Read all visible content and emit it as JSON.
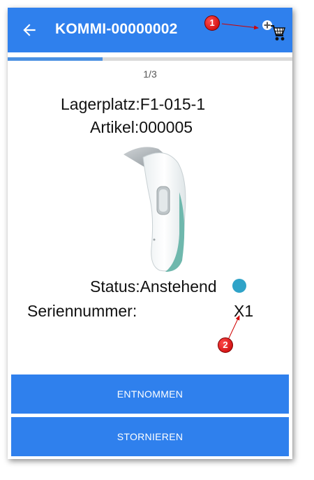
{
  "appbar": {
    "title": "KOMMI-00000002",
    "back_icon": "arrow-left-icon",
    "action_icon": "cart-add-icon",
    "color": "#2f80ed"
  },
  "progress": {
    "fraction": 0.333,
    "counter": "1/3"
  },
  "item": {
    "lagerplatz": "Lagerplatz:F1-015-1",
    "artikel": "Artikel:000005",
    "status": "Status:Anstehend",
    "status_color": "#2fa3c8",
    "serial_label": "Seriennummer:",
    "serial_value": "X1",
    "image_icon": "ear-thermometer-image"
  },
  "buttons": {
    "entnommen": "ENTNOMMEN",
    "stornieren": "STORNIEREN"
  },
  "callouts": [
    "1",
    "2"
  ]
}
